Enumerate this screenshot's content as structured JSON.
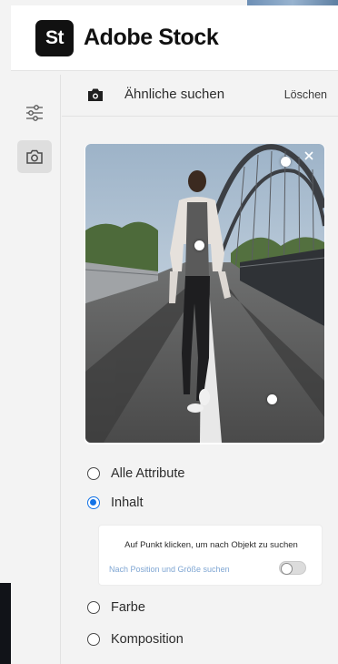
{
  "header": {
    "logo_text": "St",
    "brand_name": "Adobe Stock"
  },
  "rail": {
    "items": [
      {
        "icon": "sliders-icon",
        "active": false
      },
      {
        "icon": "camera-icon",
        "active": true
      }
    ]
  },
  "panel": {
    "title": "Ähnliche suchen",
    "clear_label": "Löschen",
    "image": {
      "icon_close": "close-icon",
      "hotspots": 3
    },
    "options": [
      {
        "label": "Alle Attribute",
        "checked": false
      },
      {
        "label": "Inhalt",
        "checked": true
      },
      {
        "label": "Farbe",
        "checked": false
      },
      {
        "label": "Komposition",
        "checked": false
      }
    ],
    "sub_option": {
      "hint": "Auf Punkt klicken, um nach Objekt zu suchen",
      "toggle_label": "Nach Position und Größe suchen",
      "toggle_on": false
    }
  },
  "colors": {
    "accent": "#1473e6",
    "background": "#f3f3f3",
    "logo_bg": "#111111"
  }
}
